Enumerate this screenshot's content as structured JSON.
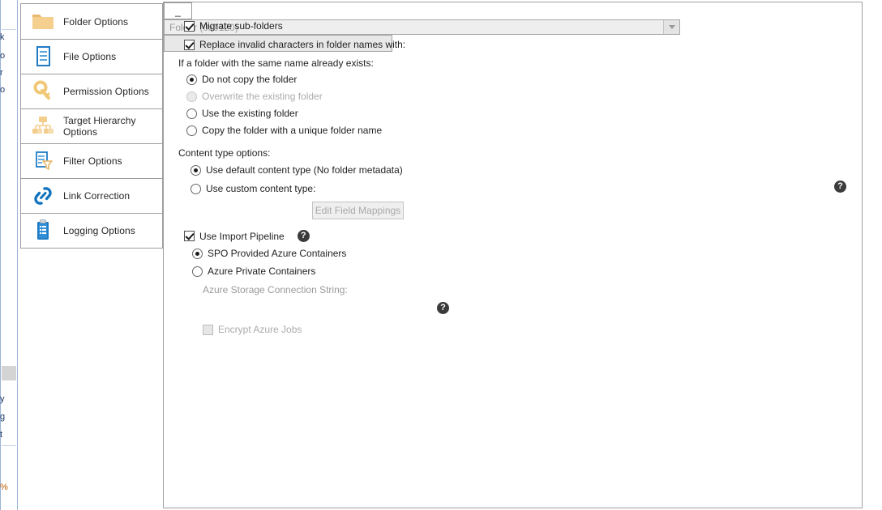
{
  "background_window": {
    "fragments": [
      "k",
      "o",
      "r",
      "o",
      "y",
      "g",
      "t",
      "%"
    ]
  },
  "sidebar": {
    "items": [
      {
        "label": "Folder Options",
        "icon": "folder-icon",
        "selected": true
      },
      {
        "label": "File Options",
        "icon": "document-icon",
        "selected": false
      },
      {
        "label": "Permission Options",
        "icon": "key-icon",
        "selected": false
      },
      {
        "label": "Target Hierarchy Options",
        "icon": "hierarchy-tree-icon",
        "selected": false
      },
      {
        "label": "Filter Options",
        "icon": "document-funnel-icon",
        "selected": false
      },
      {
        "label": "Link Correction",
        "icon": "chain-link-icon",
        "selected": false
      },
      {
        "label": "Logging Options",
        "icon": "clipboard-list-icon",
        "selected": false
      }
    ]
  },
  "folder_options": {
    "migrate_subfolders": {
      "label": "Migrate sub-folders",
      "checked": true
    },
    "replace_invalid": {
      "label": "Replace invalid characters in folder names with:",
      "checked": true,
      "value": "_"
    },
    "exists_group": {
      "heading": "If a folder with the same name already exists:",
      "options": [
        {
          "label": "Do not copy the folder",
          "selected": true,
          "disabled": false
        },
        {
          "label": "Overwrite the existing folder",
          "selected": false,
          "disabled": true
        },
        {
          "label": "Use the existing folder",
          "selected": false,
          "disabled": false
        },
        {
          "label": "Copy the folder with a unique folder name",
          "selected": false,
          "disabled": false
        }
      ]
    },
    "content_type": {
      "heading": "Content type options:",
      "default_option": {
        "label": "Use default content type (No folder metadata)",
        "selected": true
      },
      "custom_option": {
        "label": "Use custom content type:",
        "selected": false
      },
      "combo_value": "Folder (0x0120)",
      "edit_field_mappings_label": "Edit Field Mappings",
      "help_icon": "help-icon"
    },
    "import_pipeline": {
      "label": "Use Import Pipeline",
      "checked": true,
      "help_icon": "help-icon",
      "options": [
        {
          "label": "SPO Provided Azure Containers",
          "selected": true
        },
        {
          "label": "Azure Private Containers",
          "selected": false
        }
      ],
      "connection_string": {
        "label": "Azure Storage Connection String:",
        "value": "",
        "help_icon": "help-icon"
      },
      "encrypt_jobs": {
        "label": "Encrypt Azure Jobs",
        "checked": false,
        "disabled": true
      }
    }
  }
}
